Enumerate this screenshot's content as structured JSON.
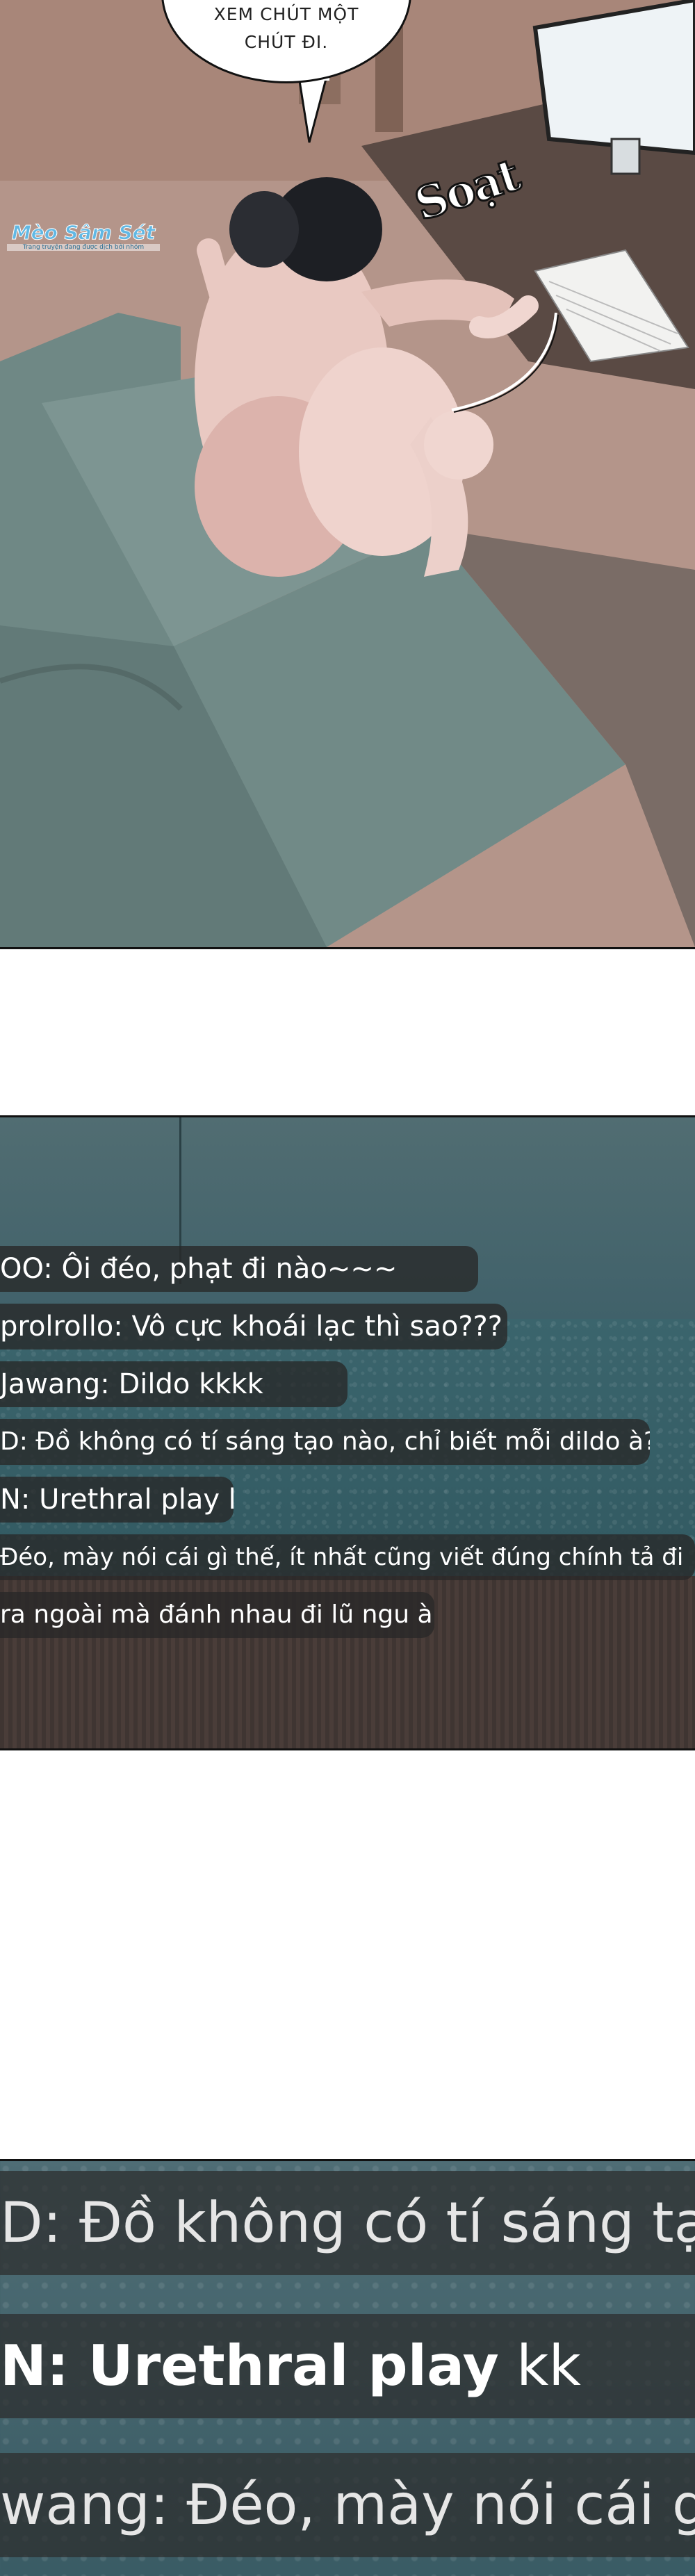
{
  "panel_room": {
    "speech_bubble": [
      "XEM CHÚT MỘT",
      "CHÚT ĐI."
    ],
    "sound_effect": "Soạt",
    "watermark_title": "Mèo Sâm Sét",
    "watermark_sub": "Trang truyện đang được dịch bởi nhóm"
  },
  "panel_chat": {
    "messages": [
      "OO: Ôi đéo, phạt đi nào~~~",
      "prolrollo: Vô cực khoái lạc thì sao???",
      "Jawang: Dildo kkkk",
      "D: Đồ không có tí sáng tạo nào, chỉ biết mỗi dildo à?",
      "N: Urethral play kk",
      "Đéo, mày nói cái gì thế, ít nhất cũng viết đúng chính tả đi",
      "ra ngoài mà đánh nhau đi lũ ngu à."
    ]
  },
  "panel_zoom": {
    "line1": "D: Đồ không có tí sáng tạo n",
    "line2_prefix": "N: ",
    "line2_highlight": "Urethral play",
    "line2_suffix": " kk",
    "line3": "wang: Đéo, mày nói cái gì th"
  }
}
